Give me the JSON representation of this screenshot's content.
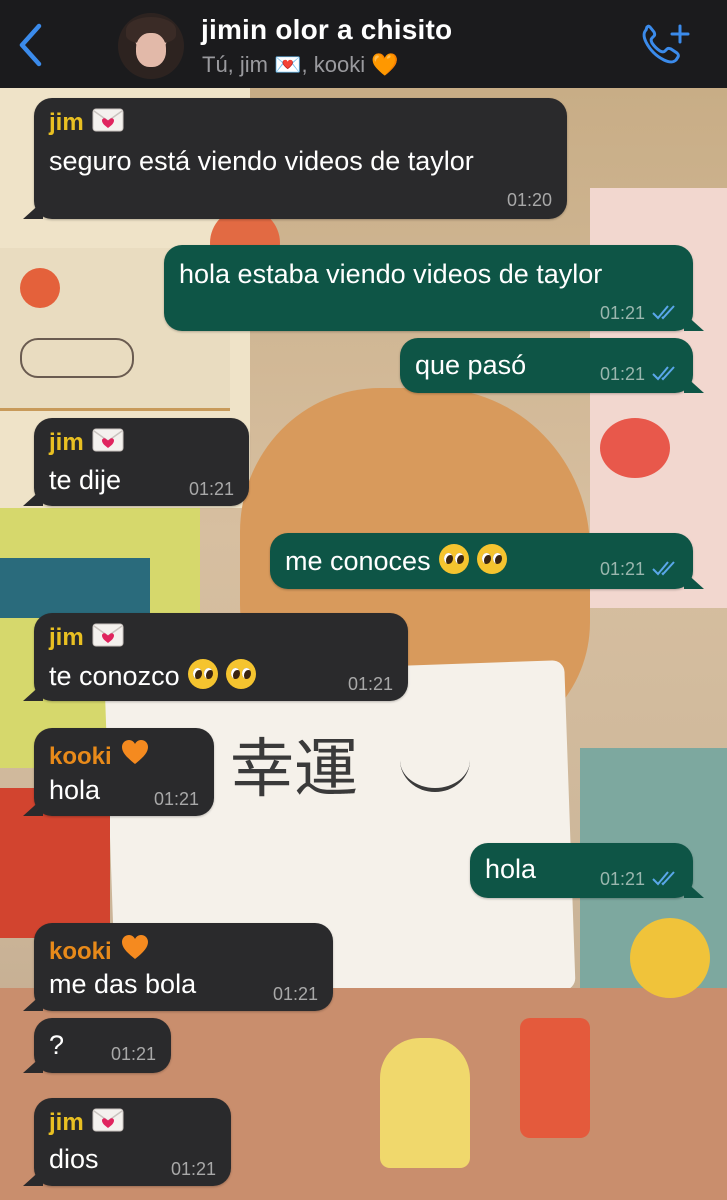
{
  "header": {
    "back_label": "back",
    "title": "jimin olor a chisito",
    "subtitle": "Tú, jim 💌, kooki 🧡"
  },
  "colors": {
    "header_bg": "#1b1b1d",
    "accent": "#3b8beb",
    "incoming_bubble": "#2a2a2c",
    "outgoing_bubble": "#0e5546",
    "name_jim": "#e9c022",
    "name_kooki": "#e88a1a",
    "read_ticks": "#5aa7ea"
  },
  "messages": [
    {
      "sender": "jim",
      "badge": "love-letter-icon",
      "text": "seguro está viendo videos de taylor",
      "time": "01:20",
      "direction": "in"
    },
    {
      "text": "hola estaba viendo videos de taylor",
      "time": "01:21",
      "direction": "out",
      "status": "read"
    },
    {
      "text": "que pasó",
      "time": "01:21",
      "direction": "out",
      "status": "read"
    },
    {
      "sender": "jim",
      "badge": "love-letter-icon",
      "text": "te dije",
      "time": "01:21",
      "direction": "in"
    },
    {
      "text": "me conoces",
      "emoji": [
        "pleading-face-icon",
        "pleading-face-icon"
      ],
      "time": "01:21",
      "direction": "out",
      "status": "read"
    },
    {
      "sender": "jim",
      "badge": "love-letter-icon",
      "text": "te conozco",
      "emoji": [
        "pleading-face-icon",
        "pleading-face-icon"
      ],
      "time": "01:21",
      "direction": "in"
    },
    {
      "sender": "kooki",
      "badge": "orange-heart-icon",
      "text": "hola",
      "time": "01:21",
      "direction": "in"
    },
    {
      "text": "hola",
      "time": "01:21",
      "direction": "out",
      "status": "read"
    },
    {
      "sender": "kooki",
      "badge": "orange-heart-icon",
      "text": "me das bola",
      "time": "01:21",
      "direction": "in"
    },
    {
      "text": "?",
      "time": "01:21",
      "direction": "in"
    },
    {
      "sender": "jim",
      "badge": "love-letter-icon",
      "text": "dios",
      "time": "01:21",
      "direction": "in"
    }
  ],
  "wallpaper": {
    "note_text": "幸運"
  }
}
